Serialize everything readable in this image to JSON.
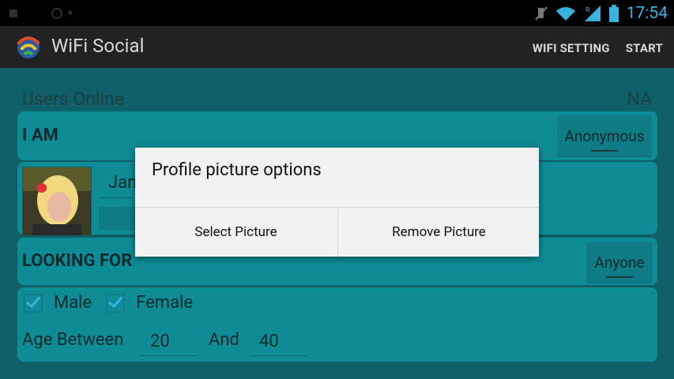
{
  "statusbar": {
    "time": "17:54"
  },
  "app": {
    "title": "WiFi Social"
  },
  "actions": {
    "wifi_setting": "WIFI SETTING",
    "start": "START"
  },
  "users": {
    "label": "Users Online",
    "value": "NA"
  },
  "iam": {
    "label": "I AM",
    "selector": "Anonymous"
  },
  "profile": {
    "name_partial": "Jan"
  },
  "looking": {
    "label": "LOOKING FOR",
    "selector": "Anyone"
  },
  "prefs": {
    "male": "Male",
    "female": "Female",
    "age_label": "Age Between",
    "age_min": "20",
    "and_label": "And",
    "age_max": "40"
  },
  "dialog": {
    "title": "Profile picture options",
    "select_label": "Select Picture",
    "remove_label": "Remove Picture"
  },
  "colors": {
    "accent": "#38b3e0",
    "card": "#0e8c96",
    "background": "#0e5f67"
  }
}
